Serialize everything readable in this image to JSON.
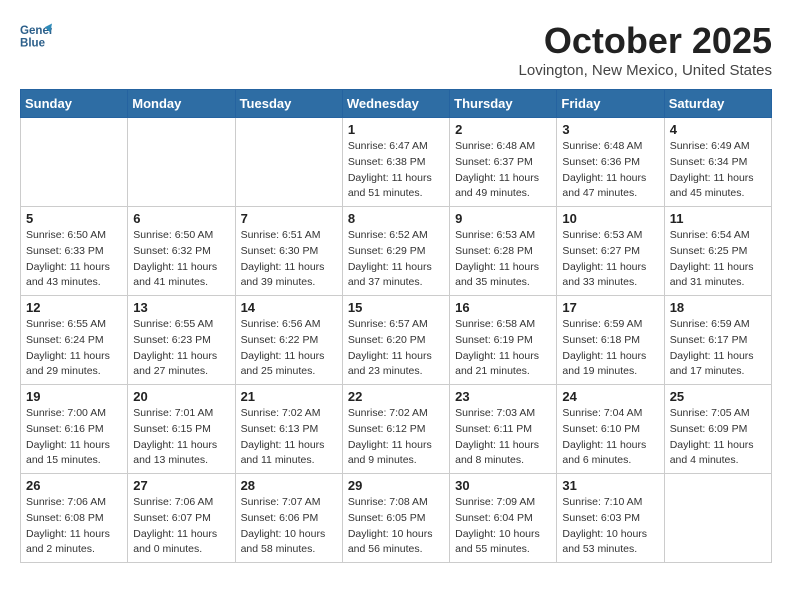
{
  "header": {
    "logo_line1": "General",
    "logo_line2": "Blue",
    "month": "October 2025",
    "location": "Lovington, New Mexico, United States"
  },
  "weekdays": [
    "Sunday",
    "Monday",
    "Tuesday",
    "Wednesday",
    "Thursday",
    "Friday",
    "Saturday"
  ],
  "weeks": [
    [
      {
        "day": "",
        "info": ""
      },
      {
        "day": "",
        "info": ""
      },
      {
        "day": "",
        "info": ""
      },
      {
        "day": "1",
        "info": "Sunrise: 6:47 AM\nSunset: 6:38 PM\nDaylight: 11 hours\nand 51 minutes."
      },
      {
        "day": "2",
        "info": "Sunrise: 6:48 AM\nSunset: 6:37 PM\nDaylight: 11 hours\nand 49 minutes."
      },
      {
        "day": "3",
        "info": "Sunrise: 6:48 AM\nSunset: 6:36 PM\nDaylight: 11 hours\nand 47 minutes."
      },
      {
        "day": "4",
        "info": "Sunrise: 6:49 AM\nSunset: 6:34 PM\nDaylight: 11 hours\nand 45 minutes."
      }
    ],
    [
      {
        "day": "5",
        "info": "Sunrise: 6:50 AM\nSunset: 6:33 PM\nDaylight: 11 hours\nand 43 minutes."
      },
      {
        "day": "6",
        "info": "Sunrise: 6:50 AM\nSunset: 6:32 PM\nDaylight: 11 hours\nand 41 minutes."
      },
      {
        "day": "7",
        "info": "Sunrise: 6:51 AM\nSunset: 6:30 PM\nDaylight: 11 hours\nand 39 minutes."
      },
      {
        "day": "8",
        "info": "Sunrise: 6:52 AM\nSunset: 6:29 PM\nDaylight: 11 hours\nand 37 minutes."
      },
      {
        "day": "9",
        "info": "Sunrise: 6:53 AM\nSunset: 6:28 PM\nDaylight: 11 hours\nand 35 minutes."
      },
      {
        "day": "10",
        "info": "Sunrise: 6:53 AM\nSunset: 6:27 PM\nDaylight: 11 hours\nand 33 minutes."
      },
      {
        "day": "11",
        "info": "Sunrise: 6:54 AM\nSunset: 6:25 PM\nDaylight: 11 hours\nand 31 minutes."
      }
    ],
    [
      {
        "day": "12",
        "info": "Sunrise: 6:55 AM\nSunset: 6:24 PM\nDaylight: 11 hours\nand 29 minutes."
      },
      {
        "day": "13",
        "info": "Sunrise: 6:55 AM\nSunset: 6:23 PM\nDaylight: 11 hours\nand 27 minutes."
      },
      {
        "day": "14",
        "info": "Sunrise: 6:56 AM\nSunset: 6:22 PM\nDaylight: 11 hours\nand 25 minutes."
      },
      {
        "day": "15",
        "info": "Sunrise: 6:57 AM\nSunset: 6:20 PM\nDaylight: 11 hours\nand 23 minutes."
      },
      {
        "day": "16",
        "info": "Sunrise: 6:58 AM\nSunset: 6:19 PM\nDaylight: 11 hours\nand 21 minutes."
      },
      {
        "day": "17",
        "info": "Sunrise: 6:59 AM\nSunset: 6:18 PM\nDaylight: 11 hours\nand 19 minutes."
      },
      {
        "day": "18",
        "info": "Sunrise: 6:59 AM\nSunset: 6:17 PM\nDaylight: 11 hours\nand 17 minutes."
      }
    ],
    [
      {
        "day": "19",
        "info": "Sunrise: 7:00 AM\nSunset: 6:16 PM\nDaylight: 11 hours\nand 15 minutes."
      },
      {
        "day": "20",
        "info": "Sunrise: 7:01 AM\nSunset: 6:15 PM\nDaylight: 11 hours\nand 13 minutes."
      },
      {
        "day": "21",
        "info": "Sunrise: 7:02 AM\nSunset: 6:13 PM\nDaylight: 11 hours\nand 11 minutes."
      },
      {
        "day": "22",
        "info": "Sunrise: 7:02 AM\nSunset: 6:12 PM\nDaylight: 11 hours\nand 9 minutes."
      },
      {
        "day": "23",
        "info": "Sunrise: 7:03 AM\nSunset: 6:11 PM\nDaylight: 11 hours\nand 8 minutes."
      },
      {
        "day": "24",
        "info": "Sunrise: 7:04 AM\nSunset: 6:10 PM\nDaylight: 11 hours\nand 6 minutes."
      },
      {
        "day": "25",
        "info": "Sunrise: 7:05 AM\nSunset: 6:09 PM\nDaylight: 11 hours\nand 4 minutes."
      }
    ],
    [
      {
        "day": "26",
        "info": "Sunrise: 7:06 AM\nSunset: 6:08 PM\nDaylight: 11 hours\nand 2 minutes."
      },
      {
        "day": "27",
        "info": "Sunrise: 7:06 AM\nSunset: 6:07 PM\nDaylight: 11 hours\nand 0 minutes."
      },
      {
        "day": "28",
        "info": "Sunrise: 7:07 AM\nSunset: 6:06 PM\nDaylight: 10 hours\nand 58 minutes."
      },
      {
        "day": "29",
        "info": "Sunrise: 7:08 AM\nSunset: 6:05 PM\nDaylight: 10 hours\nand 56 minutes."
      },
      {
        "day": "30",
        "info": "Sunrise: 7:09 AM\nSunset: 6:04 PM\nDaylight: 10 hours\nand 55 minutes."
      },
      {
        "day": "31",
        "info": "Sunrise: 7:10 AM\nSunset: 6:03 PM\nDaylight: 10 hours\nand 53 minutes."
      },
      {
        "day": "",
        "info": ""
      }
    ]
  ]
}
